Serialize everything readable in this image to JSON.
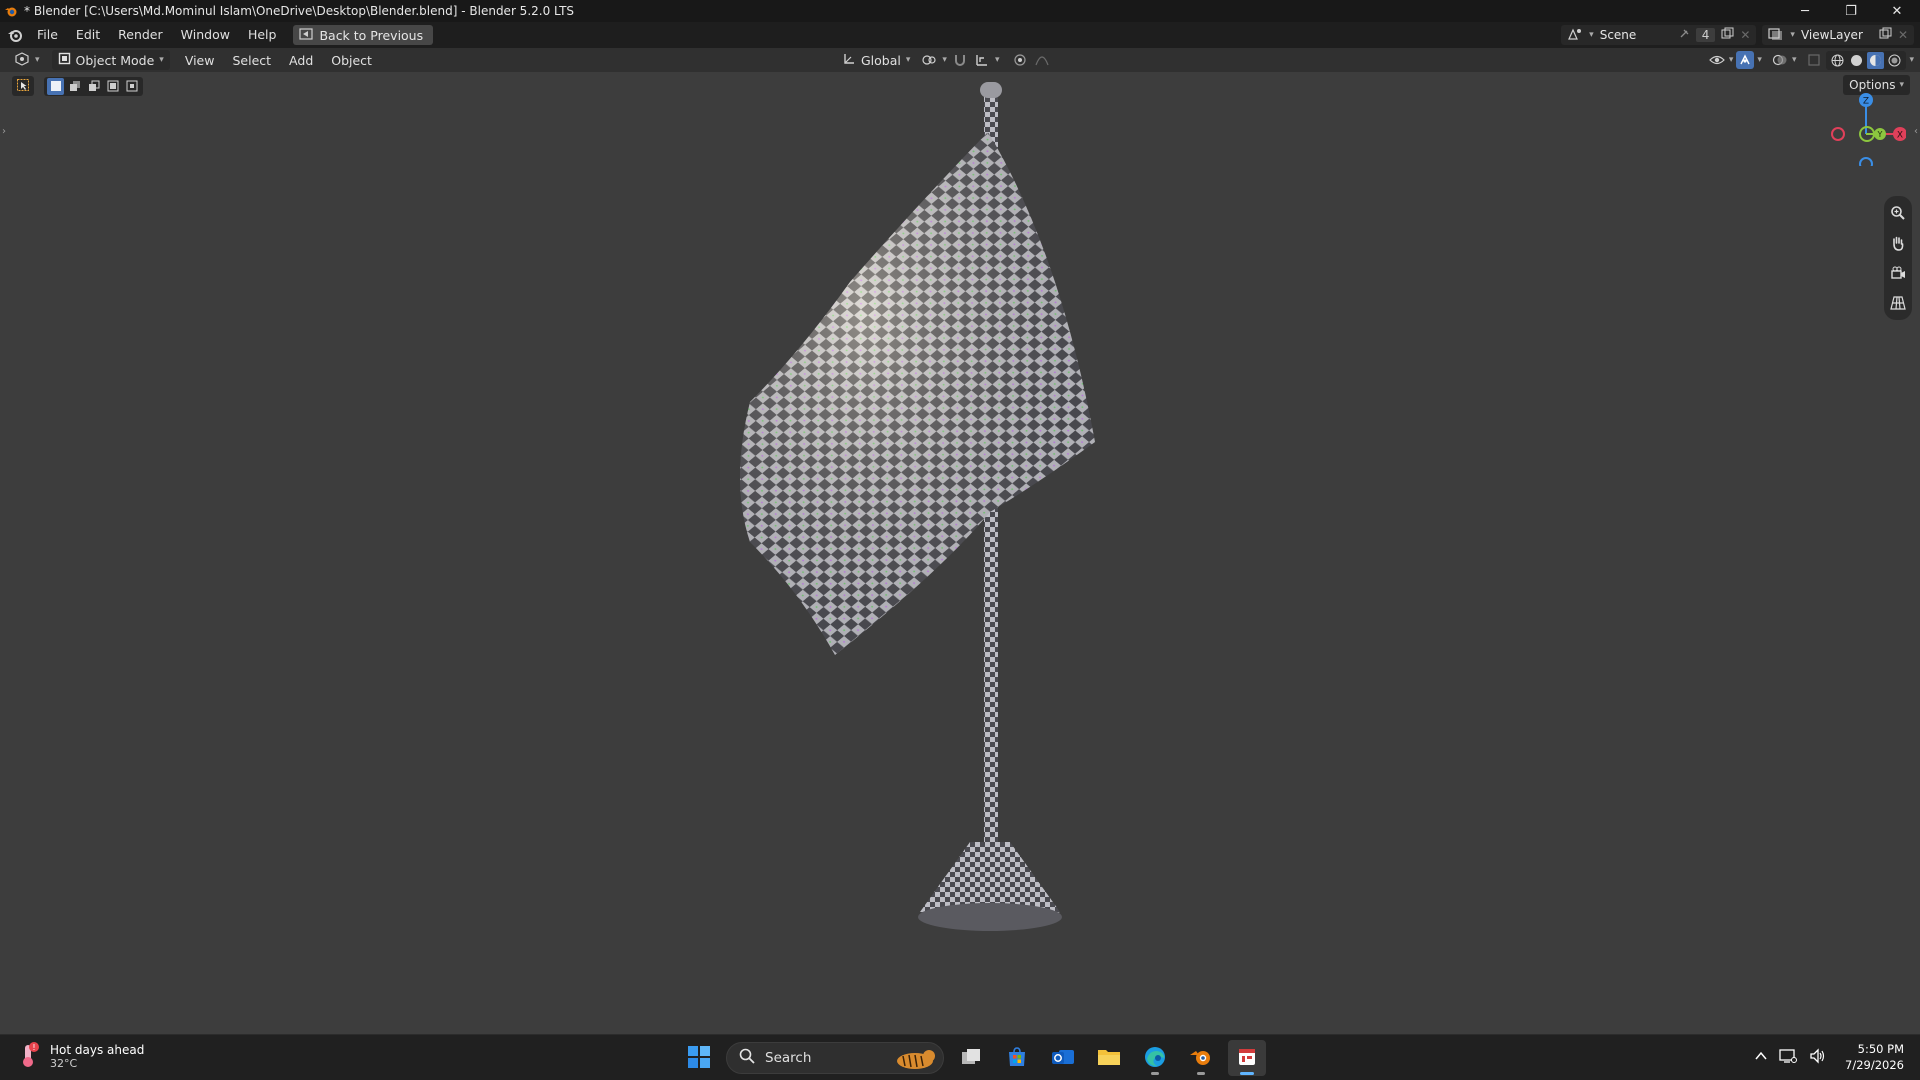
{
  "window": {
    "title": "* Blender [C:\\Users\\Md.Mominul Islam\\OneDrive\\Desktop\\Blender.blend] - Blender 5.2.0 LTS",
    "controls": {
      "minimize": "─",
      "maximize": "❐",
      "close": "✕"
    }
  },
  "menubar": {
    "items": [
      "File",
      "Edit",
      "Render",
      "Window",
      "Help"
    ],
    "back_button": "Back to Previous",
    "scene": {
      "name": "Scene",
      "count": "4"
    },
    "view_layer": "ViewLayer"
  },
  "viewport_header": {
    "mode": "Object Mode",
    "menus": [
      "View",
      "Select",
      "Add",
      "Object"
    ],
    "transform_orientation": "Global",
    "shading_active": "solid"
  },
  "viewport": {
    "options_label": "Options",
    "gizmo": {
      "z": "Z",
      "y": "Y",
      "x": "X"
    },
    "colors": {
      "x_axis": "#e0405a",
      "y_axis": "#8cc63f",
      "z_axis": "#3a8ee6",
      "accent": "#4772b3"
    }
  },
  "taskbar": {
    "weather_title": "Hot days ahead",
    "weather_temp": "32°C",
    "search_placeholder": "Search",
    "time": "5:50 PM",
    "date": "7/29/2026",
    "apps": [
      "start-icon",
      "task-view-icon",
      "store-icon",
      "outlook-icon",
      "file-explorer-icon",
      "edge-icon",
      "blender-icon",
      "app-icon"
    ]
  }
}
